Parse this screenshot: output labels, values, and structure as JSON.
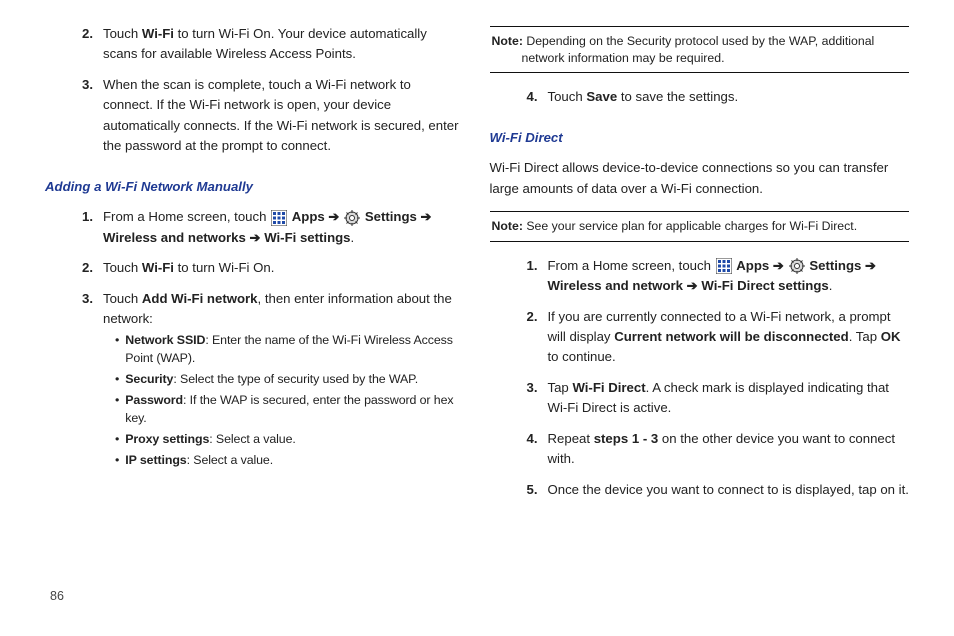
{
  "page_number": "86",
  "left": {
    "steps_top": [
      {
        "num": "2.",
        "pre": "Touch ",
        "b": "Wi-Fi",
        "post": " to turn Wi-Fi On. Your device automatically scans for available Wireless Access Points."
      },
      {
        "num": "3.",
        "text": "When the scan is complete, touch a Wi-Fi network to connect. If the Wi-Fi network is open, your device automatically connects. If the Wi-Fi network is secured, enter the password at the prompt to connect."
      }
    ],
    "subheading": "Adding a Wi-Fi Network Manually",
    "step1": {
      "num": "1.",
      "pre": "From a Home screen, touch ",
      "apps": "Apps",
      "arrow1": " ➔ ",
      "settings": "Settings",
      "arrow2": " ➔ ",
      "wan": "Wireless and networks",
      "arrow3": " ➔ ",
      "wifi_settings": "Wi-Fi settings",
      "dot": "."
    },
    "step2": {
      "num": "2.",
      "pre": "Touch ",
      "b": "Wi-Fi",
      "post": " to turn Wi-Fi On."
    },
    "step3": {
      "num": "3.",
      "pre": "Touch ",
      "b": "Add Wi-Fi network",
      "post": ", then enter information about the network:"
    },
    "bullets": [
      {
        "b": "Network SSID",
        "rest": ": Enter the name of the Wi-Fi Wireless Access Point (WAP)."
      },
      {
        "b": "Security",
        "rest": ": Select the type of security used by the WAP."
      },
      {
        "b": "Password",
        "rest": ": If the WAP is secured, enter the password or hex key."
      },
      {
        "b": "Proxy settings",
        "rest": ": Select a value."
      },
      {
        "b": "IP settings",
        "rest": ": Select a value."
      }
    ]
  },
  "right": {
    "note1_label": "Note:",
    "note1_text": " Depending on the Security protocol used by the WAP, additional",
    "note1_cont": "network information may be required.",
    "step4": {
      "num": "4.",
      "pre": "Touch ",
      "b": "Save",
      "post": " to save the settings."
    },
    "subheading": "Wi-Fi Direct",
    "intro": "Wi-Fi Direct allows device-to-device connections so you can transfer large amounts of data over a Wi-Fi connection.",
    "note2_label": "Note:",
    "note2_text": " See your service plan for applicable charges for Wi-Fi Direct.",
    "step_r1": {
      "num": "1.",
      "pre": "From a Home screen, touch ",
      "apps": "Apps",
      "arrow1": " ➔ ",
      "settings": "Settings",
      "arrow2": " ➔ ",
      "wan": "Wireless and network",
      "arrow3": " ➔ ",
      "wfd": "Wi-Fi Direct settings",
      "dot": "."
    },
    "step_r2": {
      "num": "2.",
      "pre": "If you are currently connected to a Wi-Fi network, a prompt will display ",
      "b1": "Current network will be disconnected",
      "mid": ". Tap ",
      "b2": "OK",
      "post": " to continue."
    },
    "step_r3": {
      "num": "3.",
      "pre": "Tap ",
      "b": "Wi-Fi Direct",
      "post": ". A check mark is displayed indicating that Wi-Fi Direct is active."
    },
    "step_r4": {
      "num": "4.",
      "pre": "Repeat ",
      "b": "steps 1 - 3",
      "post": " on the other device you want to connect with."
    },
    "step_r5": {
      "num": "5.",
      "text": "Once the device you want to connect to is displayed, tap on it."
    }
  }
}
